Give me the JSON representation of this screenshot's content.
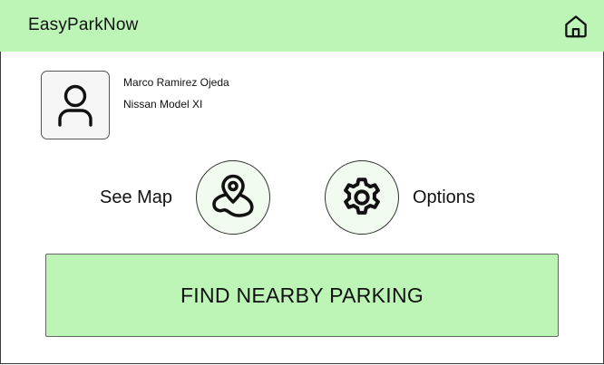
{
  "header": {
    "title": "EasyParkNow",
    "home_icon": "home-icon"
  },
  "user": {
    "name": "Marco Ramirez Ojeda",
    "vehicle": "Nissan Model XI",
    "avatar_icon": "user-icon"
  },
  "actions": {
    "map_label": "See Map",
    "map_icon": "map-pin-icon",
    "options_label": "Options",
    "options_icon": "gear-icon"
  },
  "cta": {
    "label": "FIND NEARBY PARKING"
  },
  "colors": {
    "header_bg": "#bdf5b6",
    "cta_bg": "#bdf5b6",
    "circle_bg": "#f2fbef"
  }
}
